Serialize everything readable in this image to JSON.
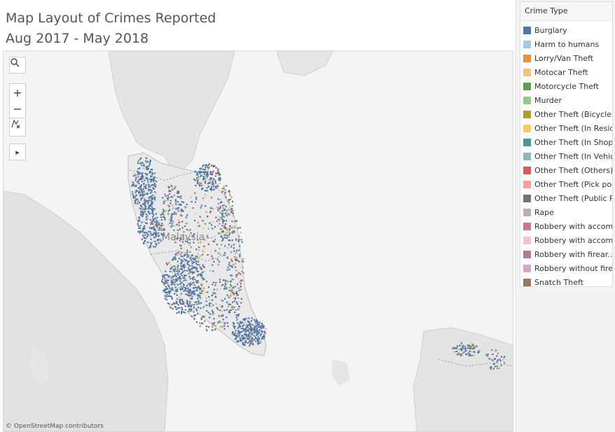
{
  "title": {
    "line1": "Map Layout of Crimes Reported",
    "line2": "Aug 2017 - May 2018"
  },
  "map": {
    "country_label": "Malaysia",
    "attribution": "© OpenStreetMap contributors",
    "tools": {
      "search_icon": "magnifier-icon",
      "zoom_in": "+",
      "zoom_out": "−",
      "reset_icon": "reset-map-icon",
      "expand": "▸"
    }
  },
  "legend": {
    "title": "Crime Type",
    "items": [
      {
        "label": "Burglary",
        "color": "#4e79a7"
      },
      {
        "label": "Harm to humans",
        "color": "#a0cbe8"
      },
      {
        "label": "Lorry/Van Theft",
        "color": "#f28e2b"
      },
      {
        "label": "Motocar Theft",
        "color": "#ffbe7d"
      },
      {
        "label": "Motorcycle Theft",
        "color": "#59a14f"
      },
      {
        "label": "Murder",
        "color": "#8cd17d"
      },
      {
        "label": "Other Theft (Bicycle)",
        "color": "#b6992d"
      },
      {
        "label": "Other Theft (In Resid..",
        "color": "#f1ce63"
      },
      {
        "label": "Other Theft (In Shop)",
        "color": "#499894"
      },
      {
        "label": "Other Theft (In Vehic..",
        "color": "#86bcb6"
      },
      {
        "label": "Other Theft (Others)",
        "color": "#e15759"
      },
      {
        "label": "Other Theft (Pick poc..",
        "color": "#ff9d9a"
      },
      {
        "label": "Other Theft (Public P..",
        "color": "#79706e"
      },
      {
        "label": "Rape",
        "color": "#bab0ac"
      },
      {
        "label": "Robbery with accom..",
        "color": "#d37295"
      },
      {
        "label": "Robbery with accom..",
        "color": "#fabfd2"
      },
      {
        "label": "Robbery with firear..",
        "color": "#b07aa1"
      },
      {
        "label": "Robbery without fire..",
        "color": "#d4a6c8"
      },
      {
        "label": "Snatch Theft",
        "color": "#9d7660"
      }
    ]
  }
}
